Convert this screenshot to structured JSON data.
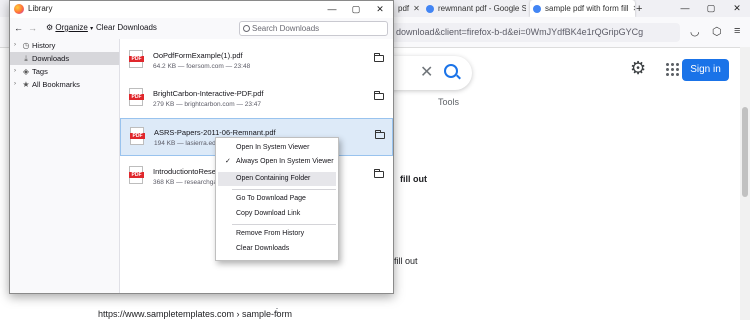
{
  "browser": {
    "tabs": [
      {
        "label": "pdf",
        "fav": "#e33"
      },
      {
        "label": "rewmnant pdf - Google S",
        "fav": "#4285f4"
      },
      {
        "label": "sample pdf with form fill",
        "fav": "#4285f4"
      }
    ],
    "new_tab": "+",
    "url": "download&client=firefox-b-d&ei=0WmJYdfBK4e1rQGripGYCg",
    "tools_label": "Tools",
    "signin_label": "Sign in",
    "snippet_1": "fill out",
    "snippet_2": "fill out",
    "bottom_url": "https://www.sampletemplates.com › sample-form",
    "bottom_dots": "⋮"
  },
  "library": {
    "title": "Library",
    "toolbar": {
      "organize": "Organize",
      "clear": "Clear Downloads",
      "search_placeholder": "Search Downloads"
    },
    "sidebar": [
      {
        "label": "History",
        "icon": "history-icon"
      },
      {
        "label": "Downloads",
        "icon": "download-icon"
      },
      {
        "label": "Tags",
        "icon": "tag-icon"
      },
      {
        "label": "All Bookmarks",
        "icon": "star-icon"
      }
    ],
    "downloads": [
      {
        "name": "OoPdfFormExample(1).pdf",
        "meta": "64.2 KB — foersom.com — 23:48"
      },
      {
        "name": "BrightCarbon-Interactive-PDF.pdf",
        "meta": "279 KB — brightcarbon.com — 23:47"
      },
      {
        "name": "ASRS-Papers-2011-06-Remnant.pdf",
        "meta": "194 KB — lasierra.edu — "
      },
      {
        "name": "IntroductiontoResearc",
        "meta": "368 KB — researchgate"
      }
    ],
    "pdf_badge": "PDF"
  },
  "context_menu": {
    "items": [
      "Open In System Viewer",
      "Always Open In System Viewer",
      "Open Containing Folder",
      "Go To Download Page",
      "Copy Download Link",
      "Remove From History",
      "Clear Downloads"
    ],
    "checkmark": "✓"
  }
}
